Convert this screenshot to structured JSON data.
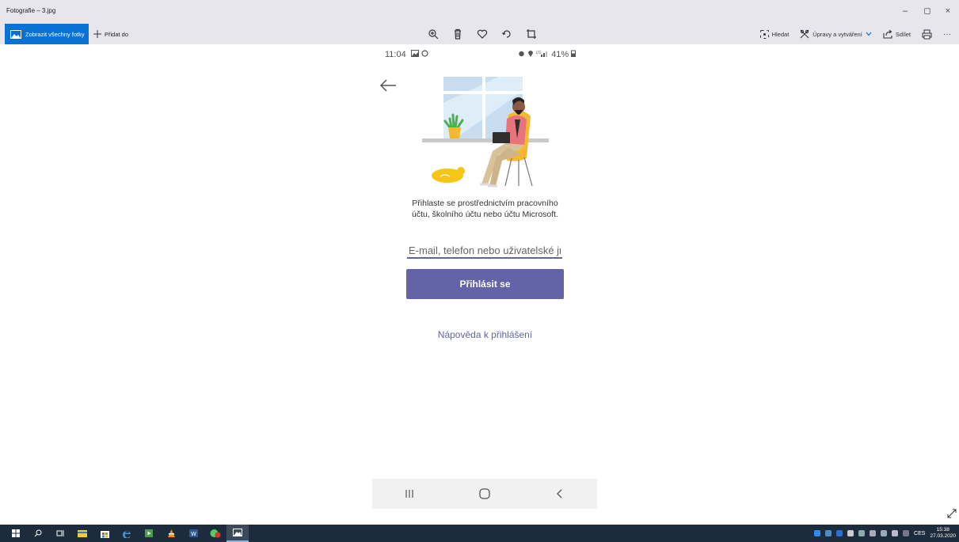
{
  "window": {
    "title": "Fotografie – 3.jpg",
    "minimize": "–",
    "maximize": "◻",
    "close": "×"
  },
  "toolbar": {
    "show_all_label": "Zobrazit všechny fotky",
    "add_to_label": "Přidat do",
    "search_label": "Hledat",
    "edit_create_label": "Úpravy a vytváření",
    "share_label": "Sdílet",
    "more_label": "···"
  },
  "phone": {
    "time": "11:04",
    "battery": "41%"
  },
  "signin": {
    "prompt": "Přihlaste se prostřednictvím pracovního účtu, školního účtu nebo účtu Microsoft.",
    "email_placeholder": "E-mail, telefon nebo uživatelské jméno",
    "button_label": "Přihlásit se",
    "help_link": "Nápověda k přihlášení"
  },
  "taskbar": {
    "language": "CES",
    "time": "15:38",
    "date": "27.03.2020"
  },
  "colors": {
    "accent": "#6264a7",
    "photos_blue": "#0a72d4",
    "taskbar": "#1d2c3c"
  }
}
